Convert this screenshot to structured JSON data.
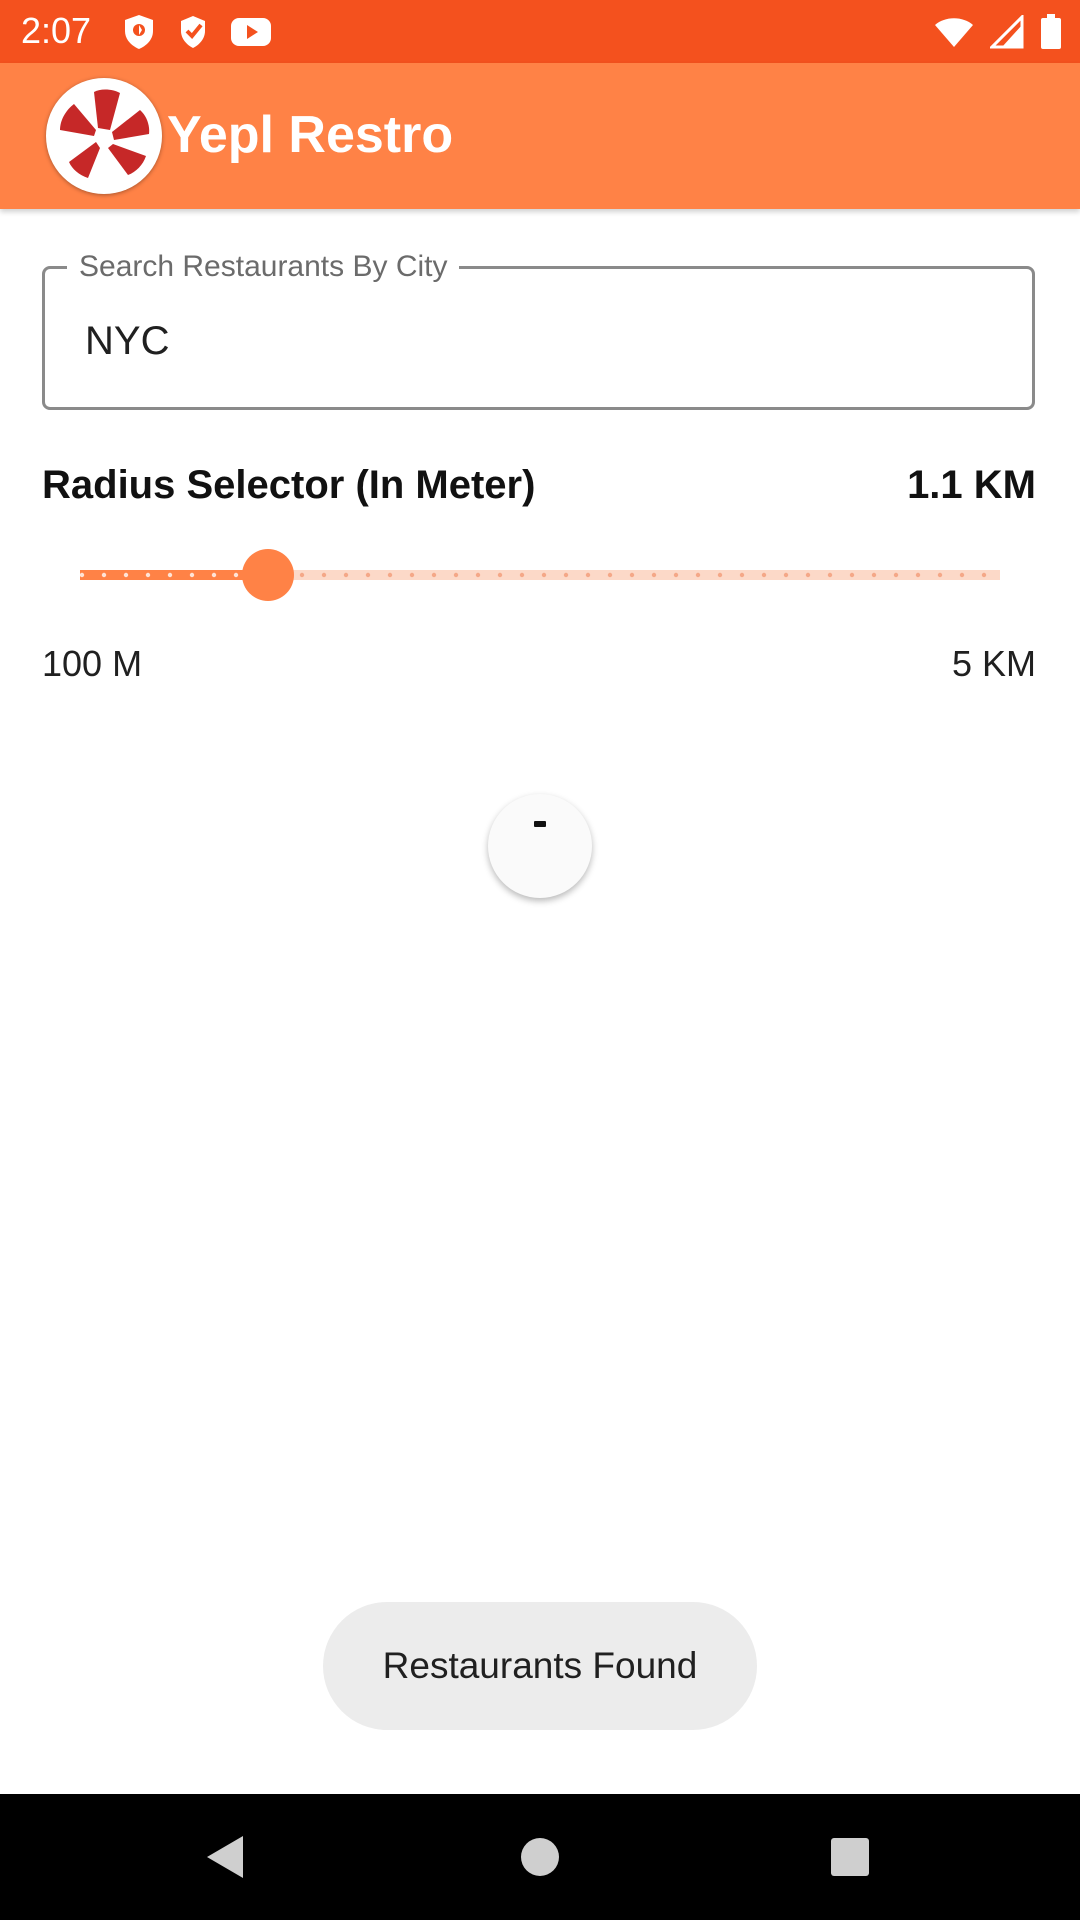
{
  "status_bar": {
    "time": "2:07",
    "left_icons": [
      "shield-icon",
      "shield-check-icon",
      "youtube-icon"
    ],
    "right_icons": [
      "wifi-icon",
      "signal-icon",
      "battery-icon"
    ],
    "color": "#f4511e"
  },
  "app_bar": {
    "title": "Yepl Restro",
    "logo": "yelp-logo",
    "color": "#ff8246"
  },
  "search": {
    "label": "Search Restaurants By City",
    "value": "NYC"
  },
  "radius": {
    "title": "Radius Selector (In Meter)",
    "value_label": "1.1 KM",
    "min_label": "100 M",
    "max_label": "5 KM",
    "slider_fraction": 0.204,
    "accent": "#ff8246"
  },
  "loading": {
    "icon": "progress-spinner"
  },
  "toast": {
    "text": "Restaurants Found"
  },
  "nav_bar": {
    "buttons": [
      "back-icon",
      "home-icon",
      "recents-icon"
    ]
  }
}
